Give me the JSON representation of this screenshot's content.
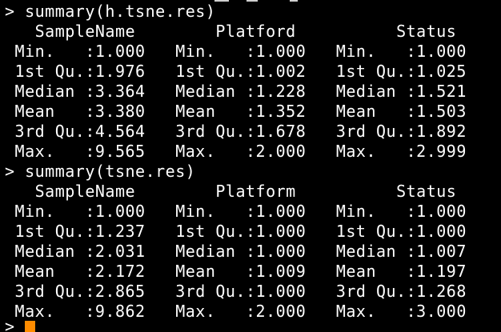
{
  "colors": {
    "background": "#000000",
    "text": "#ffffff",
    "cursor": "#ff8c00"
  },
  "terminal": {
    "lines": [
      "> summary(h.tsne.res)",
      "   SampleName        Platford          Status     ",
      " Min.   :1.000   Min.   :1.000   Min.   :1.000  ",
      " 1st Qu.:1.976   1st Qu.:1.002   1st Qu.:1.025  ",
      " Median :3.364   Median :1.228   Median :1.521  ",
      " Mean   :3.380   Mean   :1.352   Mean   :1.503  ",
      " 3rd Qu.:4.564   3rd Qu.:1.678   3rd Qu.:1.892  ",
      " Max.   :9.565   Max.   :2.000   Max.   :2.999  ",
      "> summary(tsne.res)",
      "   SampleName        Platform          Status     ",
      " Min.   :1.000   Min.   :1.000   Min.   :1.000  ",
      " 1st Qu.:1.237   1st Qu.:1.000   1st Qu.:1.000  ",
      " Median :2.031   Median :1.000   Median :1.007  ",
      " Mean   :2.172   Mean   :1.009   Mean   :1.197  ",
      " 3rd Qu.:2.865   3rd Qu.:1.000   3rd Qu.:1.268  ",
      " Max.   :9.862   Max.   :2.000   Max.   :3.000  ",
      ">"
    ]
  }
}
